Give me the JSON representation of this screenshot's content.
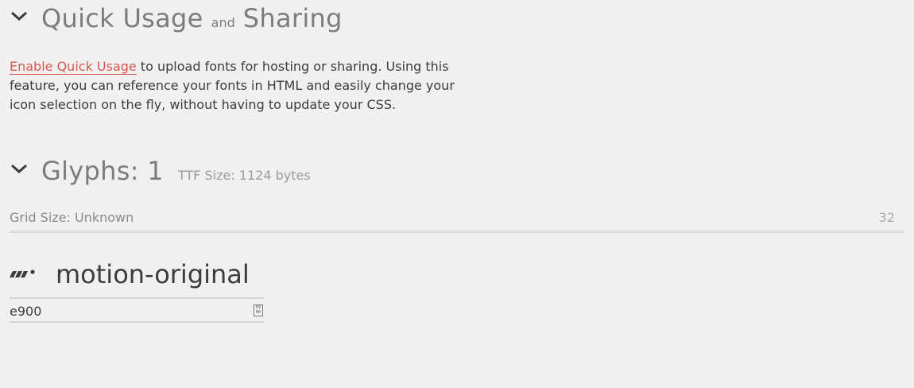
{
  "quick_usage": {
    "title_part1": "Quick Usage",
    "title_and": "and",
    "title_part2": "Sharing",
    "enable_link": "Enable Quick Usage",
    "description": " to upload fonts for hosting or sharing. Using this feature, you can reference your fonts in HTML and easily change your icon selection on the fly, without having to update your CSS."
  },
  "glyphs": {
    "title": "Glyphs: 1",
    "ttf_size": "TTF Size: 1124 bytes",
    "grid_label": "Grid Size: Unknown",
    "grid_value": "32"
  },
  "glyph": {
    "icon": "motion-icon",
    "name": "motion-original",
    "code": "e900",
    "copy_button_icon": "unicode-glyph-icon",
    "copy_button_text_top": "E9",
    "copy_button_text_bottom": "00"
  }
}
